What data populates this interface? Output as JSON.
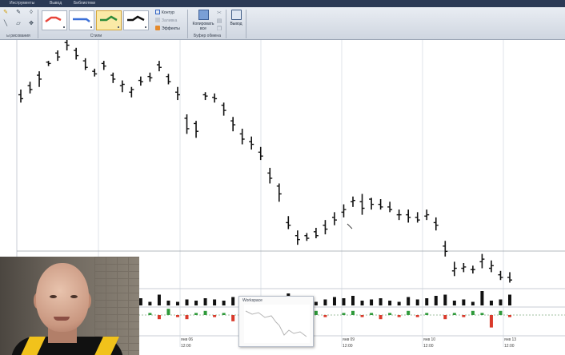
{
  "menu_tabs": [
    "Инструменты",
    "Вывод",
    "Библиотеки"
  ],
  "ribbon": {
    "drawing_group_label": "ы рисования",
    "styles_group_label": "Стили",
    "clipboard_group_label": "Буфер обмена",
    "styles": [
      {
        "name": "red-line-style",
        "color": "#e8443a",
        "active": false
      },
      {
        "name": "blue-line-style",
        "color": "#3a6fd8",
        "active": false
      },
      {
        "name": "green-line-style",
        "color": "#2e8b3a",
        "active": true
      },
      {
        "name": "black-line-style",
        "color": "#111111",
        "active": false
      }
    ],
    "contour_label": "Контур",
    "fill_label": "Заливка",
    "effects_label": "Эффекты",
    "copy_all_label": "Копировать все",
    "output_label": "Вывод"
  },
  "chart_data": {
    "type": "bar",
    "title": "",
    "date_labels": [
      "янв 06",
      "янв 09",
      "янв 10",
      "янв 13"
    ],
    "time_labels": [
      "12:00",
      "12:00",
      "12:00",
      "12:00",
      "12:00"
    ],
    "ohlc": [
      [
        78,
        82,
        72,
        75
      ],
      [
        85,
        88,
        79,
        82
      ],
      [
        93,
        96,
        84,
        90
      ],
      [
        103,
        104,
        100,
        102
      ],
      [
        110,
        112,
        104,
        107
      ],
      [
        118,
        120,
        112,
        116
      ],
      [
        112,
        114,
        105,
        108
      ],
      [
        104,
        106,
        97,
        99
      ],
      [
        96,
        98,
        92,
        94
      ],
      [
        102,
        104,
        97,
        100
      ],
      [
        93,
        95,
        87,
        90
      ],
      [
        85,
        89,
        80,
        86
      ],
      [
        80,
        84,
        76,
        82
      ],
      [
        89,
        92,
        85,
        88
      ],
      [
        92,
        95,
        88,
        91
      ],
      [
        101,
        104,
        96,
        99
      ],
      [
        92,
        94,
        86,
        88
      ],
      [
        80,
        84,
        74,
        78
      ],
      [
        60,
        63,
        48,
        52
      ],
      [
        56,
        58,
        45,
        50
      ],
      [
        78,
        80,
        74,
        77
      ],
      [
        76,
        79,
        72,
        75
      ],
      [
        70,
        72,
        62,
        66
      ],
      [
        58,
        61,
        50,
        55
      ],
      [
        48,
        52,
        40,
        44
      ],
      [
        42,
        46,
        36,
        40
      ],
      [
        34,
        38,
        28,
        31
      ],
      [
        18,
        22,
        10,
        14
      ],
      [
        8,
        10,
        -4,
        2
      ],
      [
        -20,
        -15,
        -25,
        -22
      ],
      [
        -30,
        -26,
        -37,
        -33
      ],
      [
        -30,
        -28,
        -34,
        -32
      ],
      [
        -27,
        -24,
        -32,
        -30
      ],
      [
        -22,
        -18,
        -29,
        -25
      ],
      [
        -16,
        -12,
        -22,
        -18
      ],
      [
        -12,
        -6,
        -16,
        -10
      ],
      [
        -4,
        0,
        -8,
        -3
      ],
      [
        -4,
        2,
        -14,
        -9
      ],
      [
        -2,
        -1,
        -10,
        -6
      ],
      [
        -6,
        -2,
        -10,
        -8
      ],
      [
        -8,
        -4,
        -12,
        -10
      ],
      [
        -14,
        -10,
        -18,
        -14
      ],
      [
        -14,
        -10,
        -20,
        -16
      ],
      [
        -16,
        -12,
        -20,
        -18
      ],
      [
        -15,
        -10,
        -18,
        -14
      ],
      [
        -20,
        -16,
        -26,
        -22
      ],
      [
        -38,
        -34,
        -46,
        -42
      ],
      [
        -57,
        -50,
        -61,
        -55
      ],
      [
        -55,
        -51,
        -58,
        -54
      ],
      [
        -56,
        -53,
        -59,
        -56
      ],
      [
        -50,
        -44,
        -55,
        -48
      ],
      [
        -55,
        -49,
        -58,
        -53
      ],
      [
        -60,
        -57,
        -64,
        -62
      ],
      [
        -62,
        -58,
        -66,
        -64
      ]
    ],
    "volume": [
      3,
      5,
      4,
      2,
      5,
      6,
      3,
      4,
      6,
      8,
      7,
      5,
      4,
      6,
      3,
      9,
      4,
      3,
      5,
      4,
      6,
      5,
      4,
      7,
      3,
      5,
      4,
      6,
      5,
      10,
      6,
      4,
      3,
      5,
      7,
      6,
      8,
      4,
      5,
      6,
      4,
      3,
      7,
      5,
      6,
      8,
      9,
      4,
      5,
      3,
      12,
      4,
      5,
      9
    ],
    "delta": [
      2,
      -1,
      1,
      -2,
      3,
      -1,
      0,
      -3,
      2,
      -1,
      1,
      2,
      -1,
      0,
      1,
      -2,
      3,
      -1,
      -2,
      1,
      2,
      -1,
      1,
      -3,
      0,
      2,
      -1,
      1,
      -2,
      3,
      -4,
      1,
      2,
      -1,
      0,
      1,
      2,
      -1,
      1,
      -2,
      1,
      -1,
      2,
      -1,
      1,
      0,
      -2,
      1,
      -1,
      2,
      1,
      -6,
      2,
      -1
    ]
  },
  "preview": {
    "title": "Workspace"
  }
}
